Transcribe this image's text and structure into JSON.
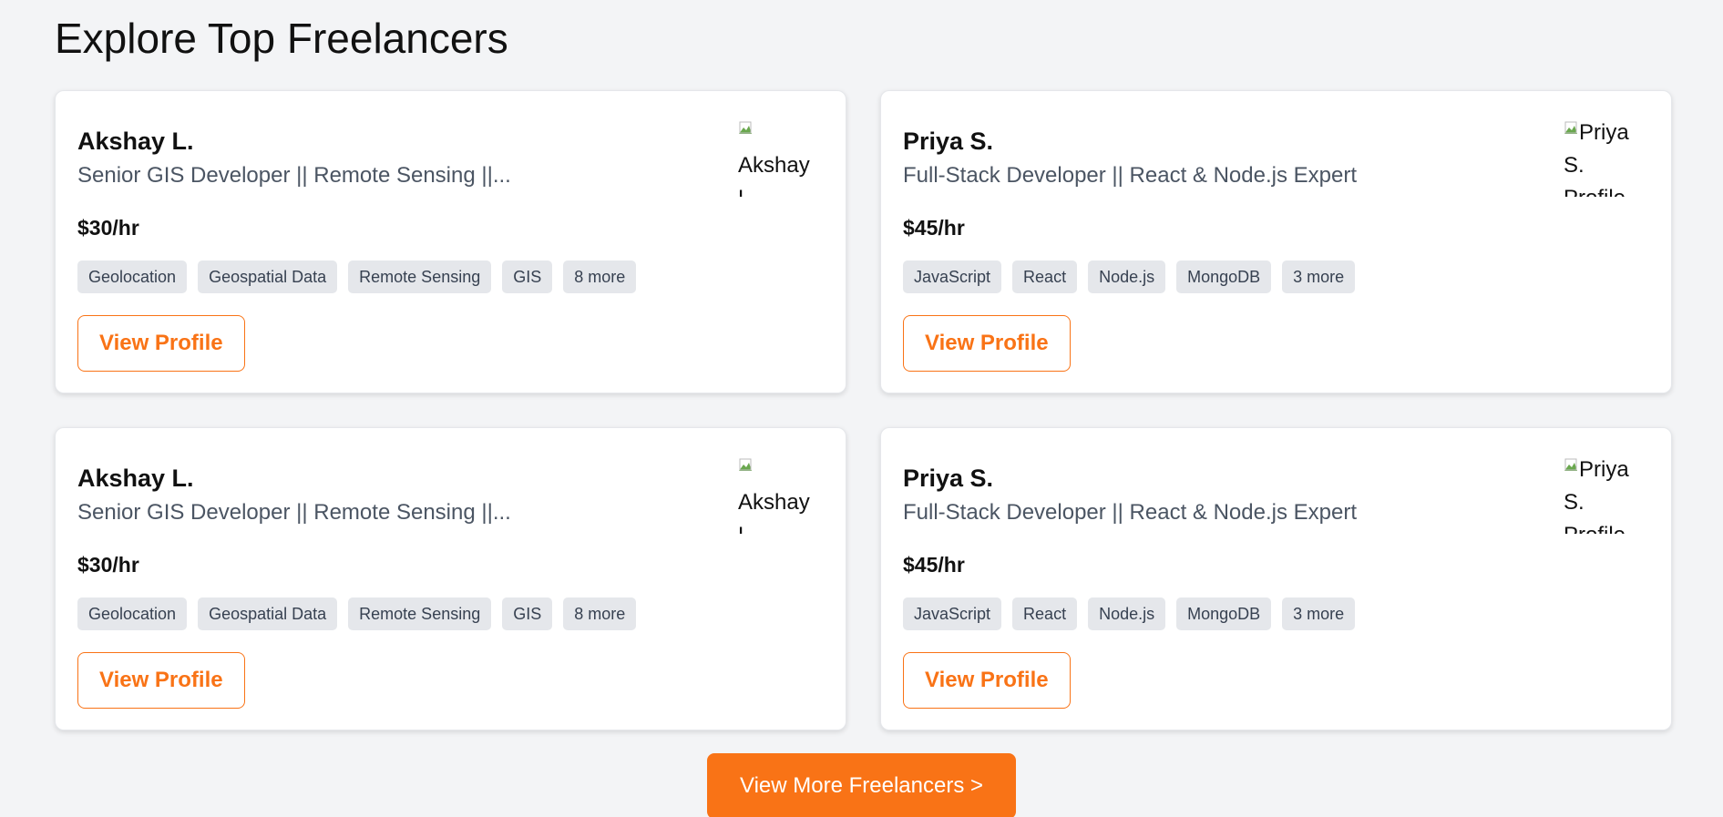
{
  "section": {
    "title": "Explore Top Freelancers"
  },
  "freelancers": [
    {
      "name": "Akshay L.",
      "headline": "Senior GIS Developer || Remote Sensing ||...",
      "rate": "$30/hr",
      "avatar_alt": "Akshay L. Profile",
      "tags": [
        "Geolocation",
        "Geospatial Data",
        "Remote Sensing",
        "GIS",
        "8 more"
      ],
      "button_label": "View Profile"
    },
    {
      "name": "Priya S.",
      "headline": "Full-Stack Developer || React & Node.js Expert",
      "rate": "$45/hr",
      "avatar_alt": "Priya S. Profile",
      "tags": [
        "JavaScript",
        "React",
        "Node.js",
        "MongoDB",
        "3 more"
      ],
      "button_label": "View Profile"
    },
    {
      "name": "Akshay L.",
      "headline": "Senior GIS Developer || Remote Sensing ||...",
      "rate": "$30/hr",
      "avatar_alt": "Akshay L. Profile",
      "tags": [
        "Geolocation",
        "Geospatial Data",
        "Remote Sensing",
        "GIS",
        "8 more"
      ],
      "button_label": "View Profile"
    },
    {
      "name": "Priya S.",
      "headline": "Full-Stack Developer || React & Node.js Expert",
      "rate": "$45/hr",
      "avatar_alt": "Priya S. Profile",
      "tags": [
        "JavaScript",
        "React",
        "Node.js",
        "MongoDB",
        "3 more"
      ],
      "button_label": "View Profile"
    }
  ],
  "view_more": {
    "label": "View More Freelancers >"
  },
  "colors": {
    "accent": "#f97316",
    "background": "#f3f4f6",
    "tag_bg": "#e5e7eb",
    "muted_text": "#4b5563"
  }
}
